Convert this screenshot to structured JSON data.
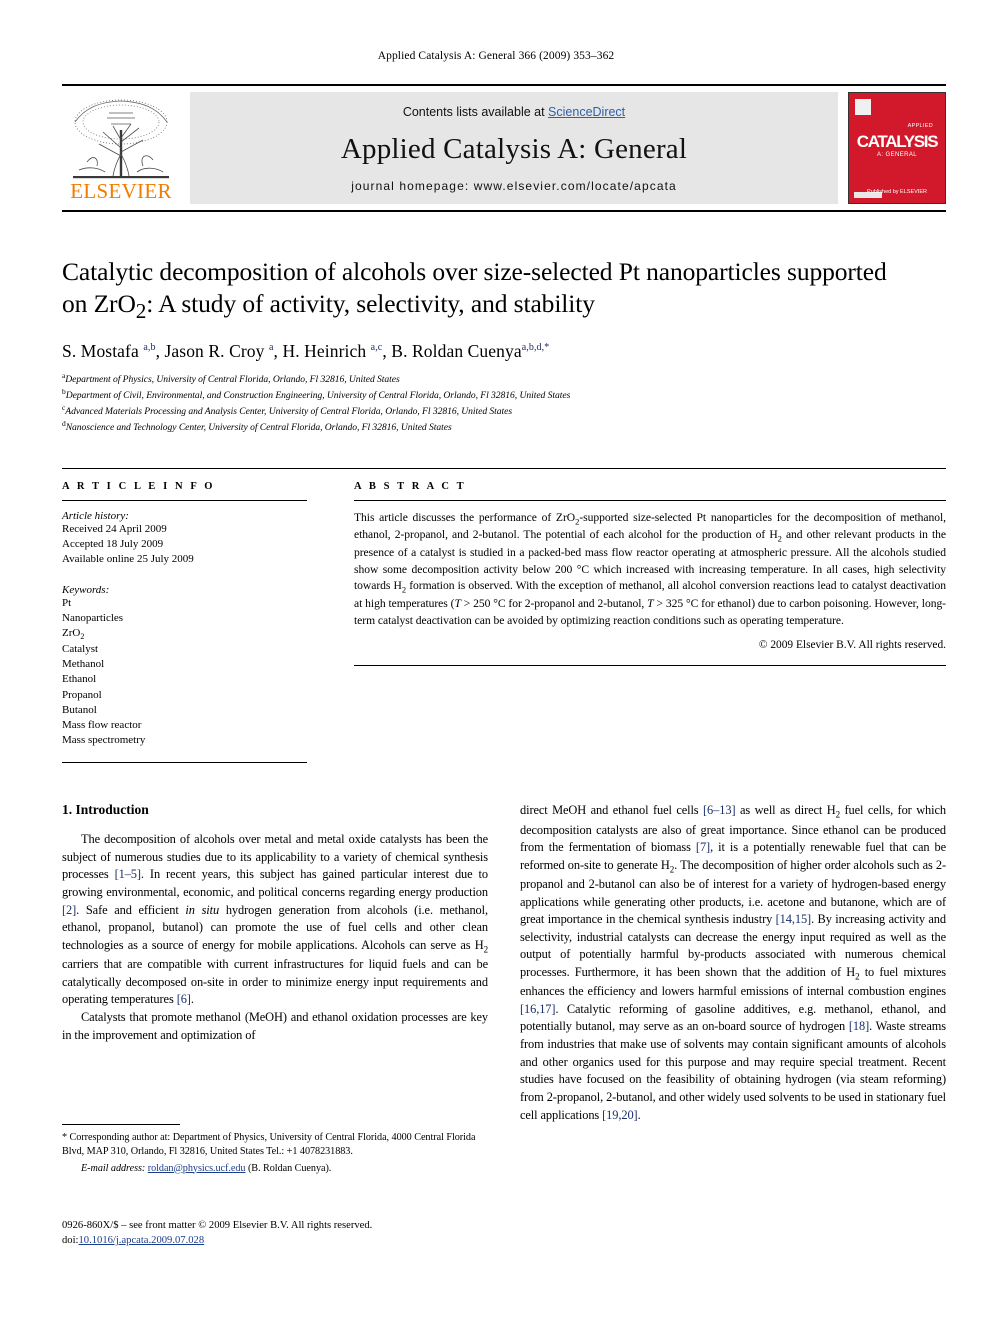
{
  "running_head": "Applied Catalysis A: General 366 (2009) 353–362",
  "banner": {
    "publisher_name": "ELSEVIER",
    "contents_prefix": "Contents lists available at ",
    "contents_link": "ScienceDirect",
    "journal_name": "Applied Catalysis A: General",
    "homepage": "journal homepage: www.elsevier.com/locate/apcata",
    "cover": {
      "title": "CATALYSIS",
      "subtitle": "A: GENERAL",
      "applied_label": "APPLIED",
      "publisher_footer": "Published by ELSEVIER"
    }
  },
  "article": {
    "title": "Catalytic decomposition of alcohols over size-selected Pt nanoparticles supported on ZrO2: A study of activity, selectivity, and stability",
    "title_line1": "Catalytic decomposition of alcohols over size-selected Pt nanoparticles supported",
    "title_line2_a": "on ZrO",
    "title_line2_sub": "2",
    "title_line2_b": ": A study of activity, selectivity, and stability",
    "authors": [
      {
        "name": "S. Mostafa ",
        "sup": "a,b"
      },
      {
        "name": ", Jason R. Croy ",
        "sup": "a"
      },
      {
        "name": ", H. Heinrich ",
        "sup": "a,c"
      },
      {
        "name": ", B. Roldan Cuenya",
        "sup": "a,b,d,*"
      }
    ],
    "affiliations": [
      {
        "label": "a",
        "text": "Department of Physics, University of Central Florida, Orlando, Fl 32816, United States"
      },
      {
        "label": "b",
        "text": "Department of Civil, Environmental, and Construction Engineering, University of Central Florida, Orlando, Fl 32816, United States"
      },
      {
        "label": "c",
        "text": "Advanced Materials Processing and Analysis Center, University of Central Florida, Orlando, Fl 32816, United States"
      },
      {
        "label": "d",
        "text": "Nanoscience and Technology Center, University of Central Florida, Orlando, Fl 32816, United States"
      }
    ]
  },
  "article_info": {
    "heading": "A R T I C L E  I N F O",
    "history_label": "Article history:",
    "history": [
      "Received 24 April 2009",
      "Accepted 18 July 2009",
      "Available online 25 July 2009"
    ],
    "keywords_label": "Keywords:",
    "keywords": [
      "Pt",
      "Nanoparticles",
      "ZrO2",
      "Catalyst",
      "Methanol",
      "Ethanol",
      "Propanol",
      "Butanol",
      "Mass flow reactor",
      "Mass spectrometry"
    ]
  },
  "abstract": {
    "heading": "A B S T R A C T",
    "text": "This article discusses the performance of ZrO2-supported size-selected Pt nanoparticles for the decomposition of methanol, ethanol, 2-propanol, and 2-butanol. The potential of each alcohol for the production of H2 and other relevant products in the presence of a catalyst is studied in a packed-bed mass flow reactor operating at atmospheric pressure. All the alcohols studied show some decomposition activity below 200 °C which increased with increasing temperature. In all cases, high selectivity towards H2 formation is observed. With the exception of methanol, all alcohol conversion reactions lead to catalyst deactivation at high temperatures (T > 250 °C for 2-propanol and 2-butanol, T > 325 °C for ethanol) due to carbon poisoning. However, long-term catalyst deactivation can be avoided by optimizing reaction conditions such as operating temperature.",
    "copyright": "© 2009 Elsevier B.V. All rights reserved."
  },
  "introduction": {
    "heading": "1. Introduction",
    "left_paragraphs": [
      "The decomposition of alcohols over metal and metal oxide catalysts has been the subject of numerous studies due to its applicability to a variety of chemical synthesis processes [1–5]. In recent years, this subject has gained particular interest due to growing environmental, economic, and political concerns regarding energy production [2]. Safe and efficient in situ hydrogen generation from alcohols (i.e. methanol, ethanol, propanol, butanol) can promote the use of fuel cells and other clean technologies as a source of energy for mobile applications. Alcohols can serve as H2 carriers that are compatible with current infrastructures for liquid fuels and can be catalytically decomposed on-site in order to minimize energy input requirements and operating temperatures [6].",
      "Catalysts that promote methanol (MeOH) and ethanol oxidation processes are key in the improvement and optimization of"
    ],
    "right_paragraphs": [
      "direct MeOH and ethanol fuel cells [6–13] as well as direct H2 fuel cells, for which decomposition catalysts are also of great importance. Since ethanol can be produced from the fermentation of biomass [7], it is a potentially renewable fuel that can be reformed on-site to generate H2. The decomposition of higher order alcohols such as 2-propanol and 2-butanol can also be of interest for a variety of hydrogen-based energy applications while generating other products, i.e. acetone and butanone, which are of great importance in the chemical synthesis industry [14,15]. By increasing activity and selectivity, industrial catalysts can decrease the energy input required as well as the output of potentially harmful by-products associated with numerous chemical processes. Furthermore, it has been shown that the addition of H2 to fuel mixtures enhances the efficiency and lowers harmful emissions of internal combustion engines [16,17]. Catalytic reforming of gasoline additives, e.g. methanol, ethanol, and potentially butanol, may serve as an on-board source of hydrogen [18]. Waste streams from industries that make use of solvents may contain significant amounts of alcohols and other organics used for this purpose and may require special treatment. Recent studies have focused on the feasibility of obtaining hydrogen (via steam reforming) from 2-propanol, 2-butanol, and other widely used solvents to be used in stationary fuel cell applications [19,20]."
    ]
  },
  "footnotes": {
    "corresponding": "* Corresponding author at: Department of Physics, University of Central Florida, 4000 Central Florida Blvd, MAP 310, Orlando, Fl 32816, United States Tel.: +1 4078231883.",
    "email_label": "E-mail address:",
    "email": "roldan@physics.ucf.edu",
    "email_owner": "(B. Roldan Cuenya).",
    "issn_line": "0926-860X/$ – see front matter © 2009 Elsevier B.V. All rights reserved.",
    "doi_label": "doi:",
    "doi": "10.1016/j.apcata.2009.07.028"
  },
  "colors": {
    "link": "#2f5fa8",
    "reference": "#1a2f6b",
    "elsevier_orange": "#f07d00",
    "cover_red": "#d1192b",
    "banner_gray": "#e6e6e6"
  }
}
